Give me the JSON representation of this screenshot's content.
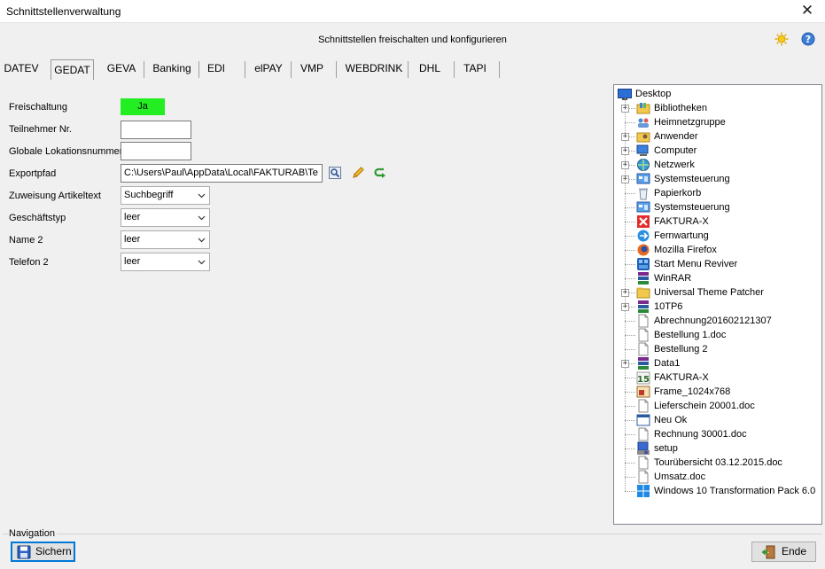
{
  "window": {
    "title": "Schnittstellenverwaltung",
    "close_glyph": "✕"
  },
  "header": {
    "caption": "Schnittstellen freischalten und konfigurieren",
    "icons": [
      "sun-icon",
      "help-icon"
    ]
  },
  "tabs": [
    "DATEV",
    "GEDAT",
    "GEVA",
    "Banking",
    "EDI",
    "elPAY",
    "VMP",
    "WEBDRINK",
    "DHL",
    "TAPI"
  ],
  "active_tab": "GEDAT",
  "form": {
    "freischaltung_label": "Freischaltung",
    "freischaltung_value": "Ja",
    "teilnehmer_label": "Teilnehmer Nr.",
    "teilnehmer_value": "",
    "gln_label": "Globale Lokationsnummer",
    "gln_value": "",
    "exportpfad_label": "Exportpfad",
    "exportpfad_value": "C:\\Users\\Paul\\AppData\\Local\\FAKTURAB\\Te",
    "zuweisung_label": "Zuweisung Artikeltext",
    "zuweisung_value": "Suchbegriff",
    "geschaeftstyp_label": "Geschäftstyp",
    "geschaeftstyp_value": "leer",
    "name2_label": "Name 2",
    "name2_value": "leer",
    "telefon2_label": "Telefon 2",
    "telefon2_value": "leer"
  },
  "tree": {
    "root": "Desktop",
    "items": [
      {
        "label": "Bibliotheken",
        "expandable": true,
        "icon": "library-folder-icon"
      },
      {
        "label": "Heimnetzgruppe",
        "expandable": false,
        "icon": "homegroup-icon"
      },
      {
        "label": "Anwender",
        "expandable": true,
        "icon": "user-folder-icon"
      },
      {
        "label": "Computer",
        "expandable": true,
        "icon": "computer-icon"
      },
      {
        "label": "Netzwerk",
        "expandable": true,
        "icon": "network-icon"
      },
      {
        "label": "Systemsteuerung",
        "expandable": true,
        "icon": "control-panel-icon"
      },
      {
        "label": "Papierkorb",
        "expandable": false,
        "icon": "recycle-bin-icon"
      },
      {
        "label": "Systemsteuerung",
        "expandable": false,
        "icon": "control-panel-icon"
      },
      {
        "label": "FAKTURA-X",
        "expandable": false,
        "icon": "faktura-x-icon"
      },
      {
        "label": "Fernwartung",
        "expandable": false,
        "icon": "remote-support-icon"
      },
      {
        "label": "Mozilla Firefox",
        "expandable": false,
        "icon": "firefox-icon"
      },
      {
        "label": "Start Menu Reviver",
        "expandable": false,
        "icon": "start-menu-reviver-icon"
      },
      {
        "label": "WinRAR",
        "expandable": false,
        "icon": "winrar-icon"
      },
      {
        "label": "Universal Theme Patcher",
        "expandable": true,
        "icon": "folder-icon"
      },
      {
        "label": "10TP6",
        "expandable": true,
        "icon": "winrar-icon"
      },
      {
        "label": "Abrechnung201602121307",
        "expandable": false,
        "icon": "document-icon"
      },
      {
        "label": "Bestellung 1.doc",
        "expandable": false,
        "icon": "document-icon"
      },
      {
        "label": "Bestellung 2",
        "expandable": false,
        "icon": "document-icon"
      },
      {
        "label": "Data1",
        "expandable": true,
        "icon": "winrar-icon"
      },
      {
        "label": "FAKTURA-X",
        "expandable": false,
        "icon": "faktura-x-15-icon"
      },
      {
        "label": "Frame_1024x768",
        "expandable": false,
        "icon": "image-icon"
      },
      {
        "label": "Lieferschein 20001.doc",
        "expandable": false,
        "icon": "document-icon"
      },
      {
        "label": "Neu Ok",
        "expandable": false,
        "icon": "window-icon"
      },
      {
        "label": "Rechnung 30001.doc",
        "expandable": false,
        "icon": "document-icon"
      },
      {
        "label": "setup",
        "expandable": false,
        "icon": "setup-icon"
      },
      {
        "label": "Tourübersicht 03.12.2015.doc",
        "expandable": false,
        "icon": "document-icon"
      },
      {
        "label": "Umsatz.doc",
        "expandable": false,
        "icon": "document-icon"
      },
      {
        "label": "Windows 10 Transformation Pack 6.0",
        "expandable": false,
        "icon": "windows-logo-icon"
      }
    ]
  },
  "navigation": {
    "label": "Navigation",
    "save_label": "Sichern",
    "end_label": "Ende"
  }
}
